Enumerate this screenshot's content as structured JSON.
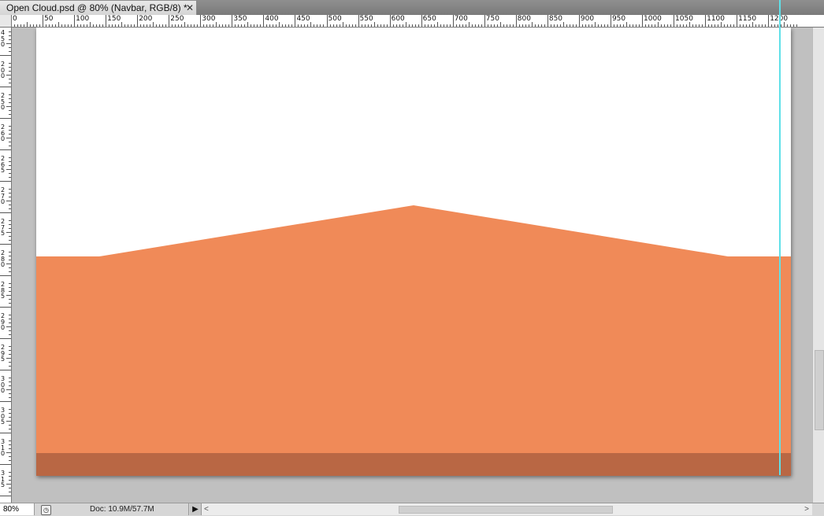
{
  "tab": {
    "title": "Open Cloud.psd @ 80% (Navbar, RGB/8) *",
    "close_glyph": "✕"
  },
  "ruler_top": {
    "labels": [
      "0",
      "50",
      "100",
      "150",
      "200",
      "250",
      "300",
      "350",
      "400",
      "450",
      "500",
      "550",
      "600",
      "650",
      "700",
      "750",
      "800",
      "850",
      "900",
      "950",
      "1000",
      "1050",
      "1100",
      "1150",
      "1200"
    ]
  },
  "ruler_left": {
    "labels": [
      "4\n5\n0",
      "2\n0\n0",
      "2\n5\n0",
      "2\n6\n0",
      "2\n6\n5",
      "2\n7\n0",
      "2\n7\n5",
      "2\n8\n0",
      "2\n8\n5",
      "2\n9\n0",
      "2\n9\n5",
      "3\n0\n0",
      "3\n0\n5",
      "3\n1\n0",
      "3\n1\n5"
    ]
  },
  "canvas": {
    "background_color": "#ffffff",
    "navbar_color": "#f08a58",
    "navbar_shadow_color": "#b96744",
    "guide_color": "#5fe0e8"
  },
  "status": {
    "zoom": "80%",
    "doc_info": "Doc: 10.9M/57.7M",
    "arrow_glyph": "▶"
  },
  "scrollbars": {
    "left_glyph": "<",
    "right_glyph": ">"
  }
}
